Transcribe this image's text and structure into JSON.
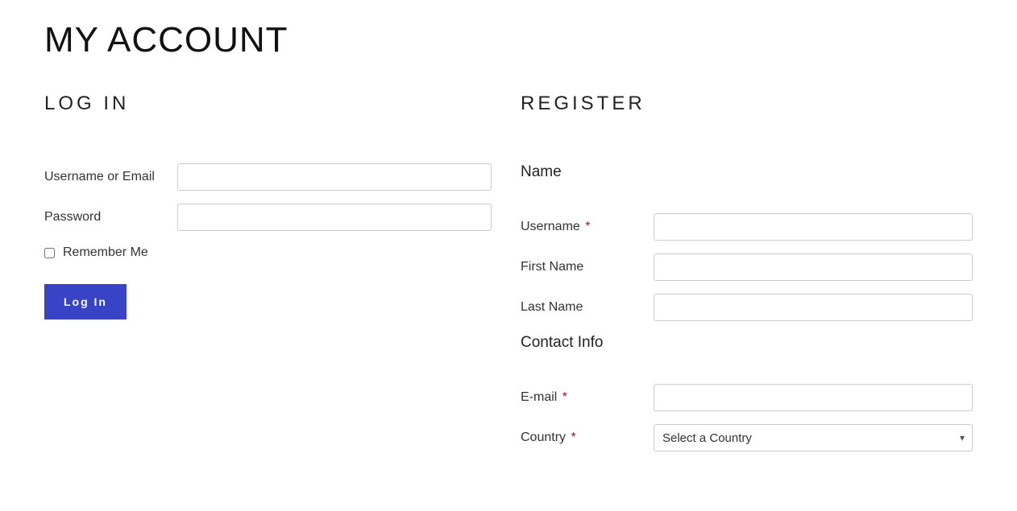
{
  "page": {
    "title": "MY ACCOUNT"
  },
  "login": {
    "heading": "LOG IN",
    "username_label": "Username or Email",
    "password_label": "Password",
    "remember_label": "Remember Me",
    "submit_label": "Log In"
  },
  "register": {
    "heading": "REGISTER",
    "section_name": "Name",
    "username_label": "Username",
    "first_name_label": "First Name",
    "last_name_label": "Last Name",
    "section_contact": "Contact Info",
    "email_label": "E-mail",
    "country_label": "Country",
    "country_placeholder": "Select a Country",
    "required_marker": "*"
  }
}
